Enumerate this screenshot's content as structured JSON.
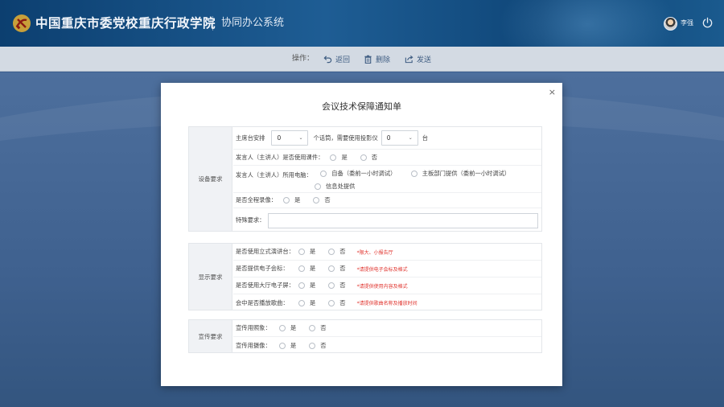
{
  "header": {
    "title": "中国重庆市委党校重庆行政学院",
    "subtitle": "协同办公系统",
    "user_name": "李强"
  },
  "toolbar": {
    "op_label": "操作：",
    "back_label": "返回",
    "delete_label": "删除",
    "send_label": "发送"
  },
  "modal": {
    "title": "会议技术保障通知单",
    "close_glyph": "×",
    "equipment": {
      "label": "设备要求",
      "row1": {
        "prefix": "主席台安排",
        "mic_value": "0",
        "middle": "个话筒，需要使用投影仪",
        "projector_value": "0",
        "suffix": "台"
      },
      "row2": {
        "question": "发言人（主讲人）是否使用课件：",
        "yes": "是",
        "no": "否"
      },
      "row3": {
        "question": "发言人（主讲人）所用电脑：",
        "opt1": "自备（委前一小时调试）",
        "opt2": "主板部门提供（委前一小时调试）",
        "opt3": "信息处提供"
      },
      "row4": {
        "question": "是否全程录像：",
        "yes": "是",
        "no": "否"
      },
      "row5": {
        "question": "特殊要求：",
        "value": ""
      }
    },
    "display": {
      "label": "显示要求",
      "rows": [
        {
          "question": "是否使用立式演讲台：",
          "yes": "是",
          "no": "否",
          "note": "*限大、小报告厅"
        },
        {
          "question": "是否提供电子会标：",
          "yes": "是",
          "no": "否",
          "note": "*请提供电子会标及格式"
        },
        {
          "question": "是否使用大厅电子屏：",
          "yes": "是",
          "no": "否",
          "note": "*请提供使用内容及格式"
        },
        {
          "question": "会中是否播放歌曲：",
          "yes": "是",
          "no": "否",
          "note": "*请提供歌曲名称及播放时间"
        }
      ]
    },
    "publicity": {
      "label": "宣传要求",
      "rows": [
        {
          "question": "宣传用照象：",
          "yes": "是",
          "no": "否"
        },
        {
          "question": "宣传用摄像：",
          "yes": "是",
          "no": "否"
        }
      ]
    }
  }
}
